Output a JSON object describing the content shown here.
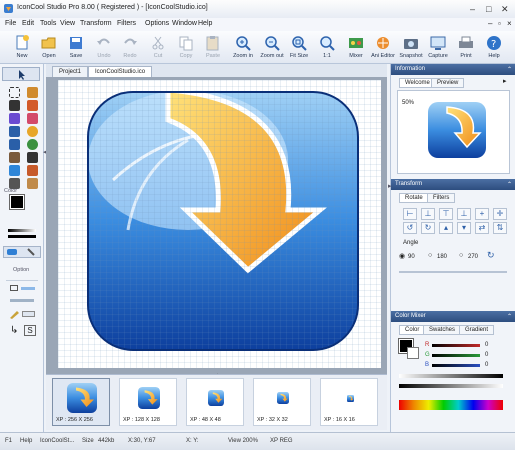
{
  "window": {
    "title": "IconCool Studio Pro 8.00 ( Registered ) - [IconCoolStudio.ico]"
  },
  "menu": [
    "File",
    "Edit",
    "Tools",
    "View",
    "Transform",
    "Filters",
    "Options",
    "Window",
    "Help"
  ],
  "toolbar": [
    {
      "label": "New",
      "icon": "new-icon",
      "enabled": true
    },
    {
      "label": "Open",
      "icon": "open-folder-icon",
      "enabled": true
    },
    {
      "label": "Save",
      "icon": "save-disk-icon",
      "enabled": true
    },
    {
      "label": "Undo",
      "icon": "undo-icon",
      "enabled": false
    },
    {
      "label": "Redo",
      "icon": "redo-icon",
      "enabled": false
    },
    {
      "label": "Cut",
      "icon": "cut-icon",
      "enabled": false
    },
    {
      "label": "Copy",
      "icon": "copy-icon",
      "enabled": false
    },
    {
      "label": "Paste",
      "icon": "paste-icon",
      "enabled": false
    },
    {
      "label": "Zoom in",
      "icon": "zoom-in-icon",
      "enabled": true
    },
    {
      "label": "Zoom out",
      "icon": "zoom-out-icon",
      "enabled": true
    },
    {
      "label": "Fit Size",
      "icon": "fit-size-icon",
      "enabled": true
    },
    {
      "label": "1:1",
      "icon": "actual-size-icon",
      "enabled": true
    },
    {
      "label": "Mixer",
      "icon": "mixer-icon",
      "enabled": true
    },
    {
      "label": "Ani Editor",
      "icon": "ani-editor-icon",
      "enabled": true
    },
    {
      "label": "Snapshot",
      "icon": "snapshot-icon",
      "enabled": true
    },
    {
      "label": "Capture",
      "icon": "capture-icon",
      "enabled": true
    },
    {
      "label": "Print",
      "icon": "print-icon",
      "enabled": true
    },
    {
      "label": "Help",
      "icon": "help-icon",
      "enabled": true
    }
  ],
  "left": {
    "color_label": "Color",
    "option_label": "Option"
  },
  "tabs": [
    "Project1",
    "IconCoolStudio.ico"
  ],
  "thumbnails": [
    "XP : 256 X 256",
    "XP : 128 X 128",
    "XP : 48 X 48",
    "XP : 32 X 32",
    "XP : 16 X 16"
  ],
  "information": {
    "title": "Information",
    "tabs": [
      "Welcome",
      "Preview"
    ],
    "zoom": "50%"
  },
  "transform": {
    "title": "Transform",
    "tabs": [
      "Rotate",
      "Filters"
    ],
    "angle_label": "Angle",
    "angles": [
      "90",
      "180",
      "270"
    ]
  },
  "color_mixer": {
    "title": "Color Mixer",
    "tabs": [
      "Color",
      "Swatches",
      "Gradient"
    ],
    "channels": [
      {
        "name": "R",
        "value": "0"
      },
      {
        "name": "G",
        "value": "0"
      },
      {
        "name": "B",
        "value": "0"
      }
    ]
  },
  "status": {
    "f1": "F1",
    "help": "Help",
    "file": "IconCoolSt...",
    "size_label": "Size",
    "size": "442kb",
    "pos1": "X:30, Y:67",
    "pos2": "X: Y:",
    "view": "View 200%",
    "format": "XP REG"
  },
  "colors": {
    "accent": "#2d4d7f",
    "canvas_bg": "#9aa6b6"
  }
}
